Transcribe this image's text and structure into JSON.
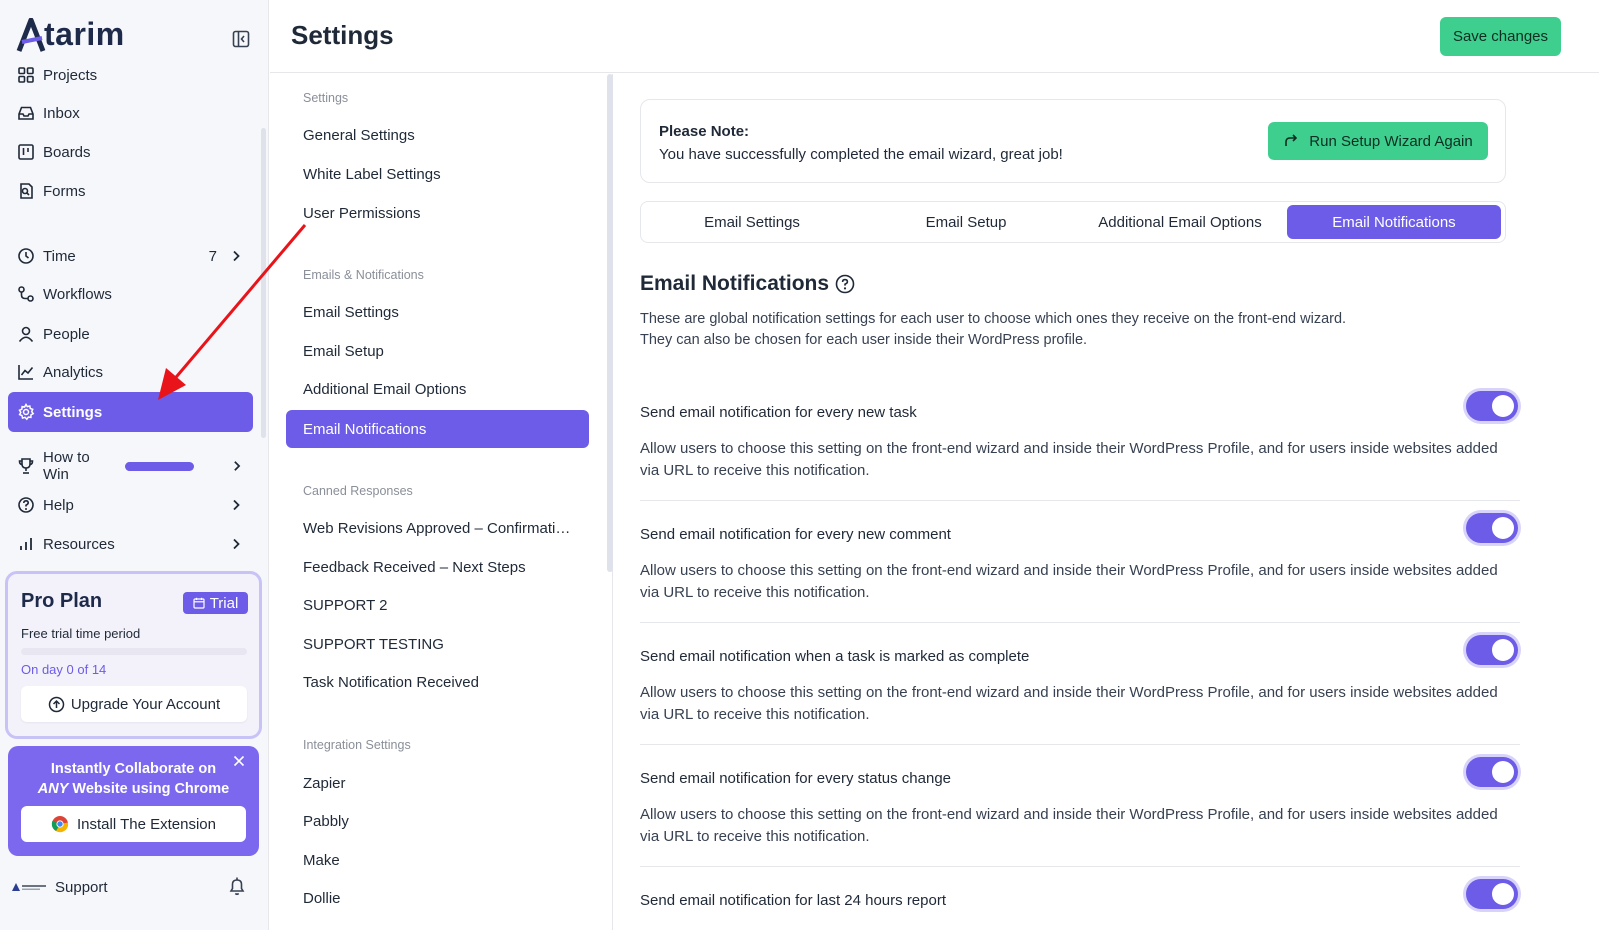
{
  "app": {
    "logo_text": "tarim"
  },
  "sidebar": {
    "items": [
      {
        "label": "Projects",
        "icon": "grid-icon"
      },
      {
        "label": "Inbox",
        "icon": "inbox-icon"
      },
      {
        "label": "Boards",
        "icon": "board-icon"
      },
      {
        "label": "Forms",
        "icon": "form-icon"
      },
      {
        "label": "Time",
        "icon": "clock-icon",
        "count": "7"
      },
      {
        "label": "Workflows",
        "icon": "workflow-icon"
      },
      {
        "label": "People",
        "icon": "person-icon"
      },
      {
        "label": "Analytics",
        "icon": "chart-icon"
      },
      {
        "label": "Settings",
        "icon": "gear-icon"
      },
      {
        "label": "How to Win",
        "icon": "trophy-icon"
      },
      {
        "label": "Help",
        "icon": "help-icon"
      },
      {
        "label": "Resources",
        "icon": "bar-chart-icon"
      }
    ],
    "plan": {
      "title": "Pro Plan",
      "badge": "Trial",
      "subtitle": "Free trial time period",
      "progress": 0,
      "day_text": "On day 0 of 14",
      "upgrade_label": "Upgrade Your Account"
    },
    "promo": {
      "line1": "Instantly Collaborate on",
      "line2_em": "ANY",
      "line2_rest": " Website using Chrome",
      "button": "Install The Extension"
    },
    "support_label": "Support"
  },
  "header": {
    "title": "Settings",
    "save_label": "Save changes"
  },
  "subnav": {
    "groups": [
      {
        "title": "Settings",
        "items": [
          "General Settings",
          "White Label Settings",
          "User Permissions"
        ]
      },
      {
        "title": "Emails & Notifications",
        "items": [
          "Email Settings",
          "Email Setup",
          "Additional Email Options",
          "Email Notifications"
        ]
      },
      {
        "title": "Canned Responses",
        "items": [
          "Web Revisions Approved – Confirmati…",
          "Feedback Received – Next Steps",
          "SUPPORT 2",
          "SUPPORT TESTING",
          "Task Notification Received"
        ]
      },
      {
        "title": "Integration Settings",
        "items": [
          "Zapier",
          "Pabbly",
          "Make",
          "Dollie"
        ]
      }
    ]
  },
  "main": {
    "note": {
      "title": "Please Note:",
      "text": "You have successfully completed the email wizard, great job!",
      "button": "Run Setup Wizard Again"
    },
    "tabs": [
      "Email Settings",
      "Email Setup",
      "Additional Email Options",
      "Email Notifications"
    ],
    "active_tab": "Email Notifications",
    "section_title": "Email Notifications",
    "section_desc_1": "These are global notification settings for each user to choose which ones they receive on the front-end wizard.",
    "section_desc_2": "They can also be chosen for each user inside their WordPress profile.",
    "notifications": [
      {
        "title": "Send email notification for every new task",
        "desc": "Allow users to choose this setting on the front-end wizard and inside their WordPress Profile, and for users inside websites added via URL to receive this notification.",
        "enabled": true
      },
      {
        "title": "Send email notification for every new comment",
        "desc": "Allow users to choose this setting on the front-end wizard and inside their WordPress Profile, and for users inside websites added via URL to receive this notification.",
        "enabled": true
      },
      {
        "title": "Send email notification when a task is marked as complete",
        "desc": "Allow users to choose this setting on the front-end wizard and inside their WordPress Profile, and for users inside websites added via URL to receive this notification.",
        "enabled": true
      },
      {
        "title": "Send email notification for every status change",
        "desc": "Allow users to choose this setting on the front-end wizard and inside their WordPress Profile, and for users inside websites added via URL to receive this notification.",
        "enabled": true
      },
      {
        "title": "Send email notification for last 24 hours report",
        "desc": "",
        "enabled": true
      }
    ]
  },
  "colors": {
    "accent": "#6c5ce7",
    "success": "#3ecf8e",
    "annotation_arrow": "#e8141a"
  }
}
